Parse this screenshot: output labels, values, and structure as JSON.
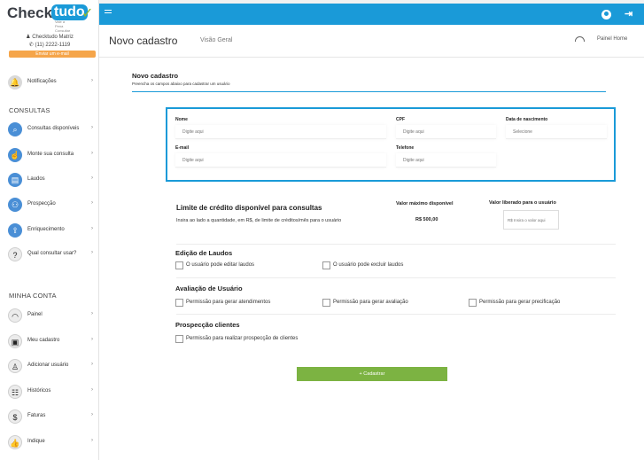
{
  "brand": {
    "name_part1": "Check",
    "name_part2": "tudo",
    "tagline": "Vale a Pena Consultar"
  },
  "account": {
    "name": "Checktudo Matriz",
    "phone": "(11) 2222-1119",
    "email_button": "Enviar um e-mail"
  },
  "sidebar": {
    "top_items": [
      {
        "label": "Notificações",
        "icon": "bell-icon"
      }
    ],
    "consultas_title": "CONSULTAS",
    "consultas": [
      {
        "label": "Consultas disponíveis",
        "icon": "search-docs-icon"
      },
      {
        "label": "Monte sua consulta",
        "icon": "hand-pointer-icon"
      },
      {
        "label": "Laudos",
        "icon": "document-icon"
      },
      {
        "label": "Prospecção",
        "icon": "users-icon"
      },
      {
        "label": "Enriquecimento",
        "icon": "upload-icon"
      },
      {
        "label": "Qual consultar usar?",
        "icon": "question-icon"
      }
    ],
    "minha_conta_title": "MINHA CONTA",
    "minha_conta": [
      {
        "label": "Painel",
        "icon": "gauge-icon"
      },
      {
        "label": "Meu cadastro",
        "icon": "profile-icon"
      },
      {
        "label": "Adicionar usuário",
        "icon": "add-user-icon"
      },
      {
        "label": "Históricos",
        "icon": "history-icon"
      },
      {
        "label": "Faturas",
        "icon": "dollar-icon"
      },
      {
        "label": "Indique",
        "icon": "thumbs-up-icon"
      }
    ]
  },
  "header": {
    "title": "Novo cadastro",
    "subtitle": "Visão Geral",
    "breadcrumb": "Painel Home"
  },
  "form": {
    "title": "Novo cadastro",
    "subtitle": "Preencha os campos abaixo para cadastrar um usuário",
    "fields": {
      "nome": {
        "label": "Nome",
        "placeholder": "Digite aqui"
      },
      "cpf": {
        "label": "CPF",
        "placeholder": "Digite aqui"
      },
      "nascimento": {
        "label": "Data de nascimento",
        "placeholder": "Selecione"
      },
      "email": {
        "label": "E-mail",
        "placeholder": "Digite aqui"
      },
      "telefone": {
        "label": "Telefone",
        "placeholder": "Digite aqui"
      }
    },
    "credit": {
      "title": "Limite de crédito disponível para consultas",
      "subtitle": "Insira ao lado a quantidade, em R$, de limite de créditos/mês para o usuário",
      "max_label": "Valor máximo disponível",
      "max_value": "R$ 500,00",
      "liberado_label": "Valor liberado para o usuário",
      "liberado_placeholder": "R$ Insira o valor aqui"
    },
    "laudos": {
      "title": "Edição de Laudos",
      "options": [
        "O usuário pode editar laudos",
        "O usuário pode excluir laudos"
      ]
    },
    "avaliacao": {
      "title": "Avaliação de Usuário",
      "options": [
        "Permissão para gerar atendimentos",
        "Permissão para gerar avaliação",
        "Permissão para gerar precificação"
      ]
    },
    "prospeccao": {
      "title": "Prospecção clientes",
      "options": [
        "Permissão para realizar prospecção de clientes"
      ]
    },
    "submit": "+ Cadastrar"
  },
  "colors": {
    "primary": "#1a9ad8",
    "accent_green": "#7cb342",
    "email_button": "#f5a54a"
  }
}
